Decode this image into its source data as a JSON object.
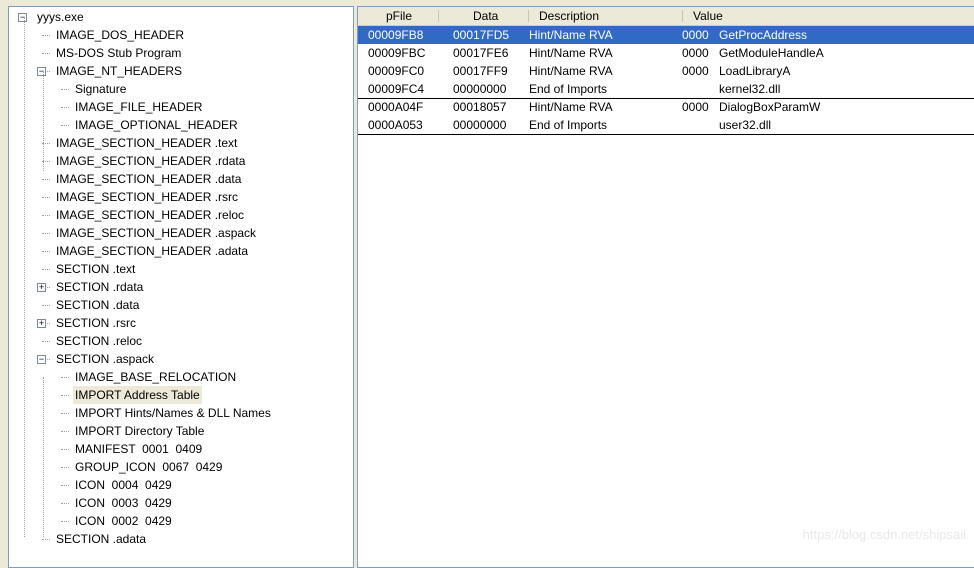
{
  "tree": [
    {
      "label": "yyys.exe",
      "level": 0,
      "expander": "minus"
    },
    {
      "label": "IMAGE_DOS_HEADER",
      "level": 1
    },
    {
      "label": "MS-DOS Stub Program",
      "level": 1
    },
    {
      "label": "IMAGE_NT_HEADERS",
      "level": 1,
      "expander": "minus"
    },
    {
      "label": "Signature",
      "level": 2
    },
    {
      "label": "IMAGE_FILE_HEADER",
      "level": 2
    },
    {
      "label": "IMAGE_OPTIONAL_HEADER",
      "level": 2
    },
    {
      "label": "IMAGE_SECTION_HEADER .text",
      "level": 1
    },
    {
      "label": "IMAGE_SECTION_HEADER .rdata",
      "level": 1
    },
    {
      "label": "IMAGE_SECTION_HEADER .data",
      "level": 1
    },
    {
      "label": "IMAGE_SECTION_HEADER .rsrc",
      "level": 1
    },
    {
      "label": "IMAGE_SECTION_HEADER .reloc",
      "level": 1
    },
    {
      "label": "IMAGE_SECTION_HEADER .aspack",
      "level": 1
    },
    {
      "label": "IMAGE_SECTION_HEADER .adata",
      "level": 1
    },
    {
      "label": "SECTION .text",
      "level": 1
    },
    {
      "label": "SECTION .rdata",
      "level": 1,
      "expander": "plus"
    },
    {
      "label": "SECTION .data",
      "level": 1
    },
    {
      "label": "SECTION .rsrc",
      "level": 1,
      "expander": "plus"
    },
    {
      "label": "SECTION .reloc",
      "level": 1
    },
    {
      "label": "SECTION .aspack",
      "level": 1,
      "expander": "minus"
    },
    {
      "label": "IMAGE_BASE_RELOCATION",
      "level": 2
    },
    {
      "label": "IMPORT Address Table",
      "level": 2,
      "selected": true
    },
    {
      "label": "IMPORT Hints/Names & DLL Names",
      "level": 2
    },
    {
      "label": "IMPORT Directory Table",
      "level": 2
    },
    {
      "label": "MANIFEST  0001  0409",
      "level": 2
    },
    {
      "label": "GROUP_ICON  0067  0429",
      "level": 2
    },
    {
      "label": "ICON  0004  0429",
      "level": 2
    },
    {
      "label": "ICON  0003  0429",
      "level": 2
    },
    {
      "label": "ICON  0002  0429",
      "level": 2
    },
    {
      "label": "SECTION .adata",
      "level": 1
    }
  ],
  "columns": [
    "pFile",
    "Data",
    "Description",
    "Value"
  ],
  "rows": [
    {
      "pfile": "00009FB8",
      "data": "00017FD5",
      "desc": "Hint/Name RVA",
      "hint": "0000",
      "name": "GetProcAddress",
      "selected": true
    },
    {
      "pfile": "00009FBC",
      "data": "00017FE6",
      "desc": "Hint/Name RVA",
      "hint": "0000",
      "name": "GetModuleHandleA"
    },
    {
      "pfile": "00009FC0",
      "data": "00017FF9",
      "desc": "Hint/Name RVA",
      "hint": "0000",
      "name": "LoadLibraryA"
    },
    {
      "pfile": "00009FC4",
      "data": "00000000",
      "desc": "End of Imports",
      "hint": "",
      "name": "kernel32.dll",
      "divider": true
    },
    {
      "pfile": "0000A04F",
      "data": "00018057",
      "desc": "Hint/Name RVA",
      "hint": "0000",
      "name": "DialogBoxParamW"
    },
    {
      "pfile": "0000A053",
      "data": "00000000",
      "desc": "End of Imports",
      "hint": "",
      "name": "user32.dll",
      "divider": true
    }
  ],
  "colors": {
    "selection": "#316ac5",
    "tree_selection": "#ece9d8"
  },
  "watermark": "https://blog.csdn.net/shipsail"
}
